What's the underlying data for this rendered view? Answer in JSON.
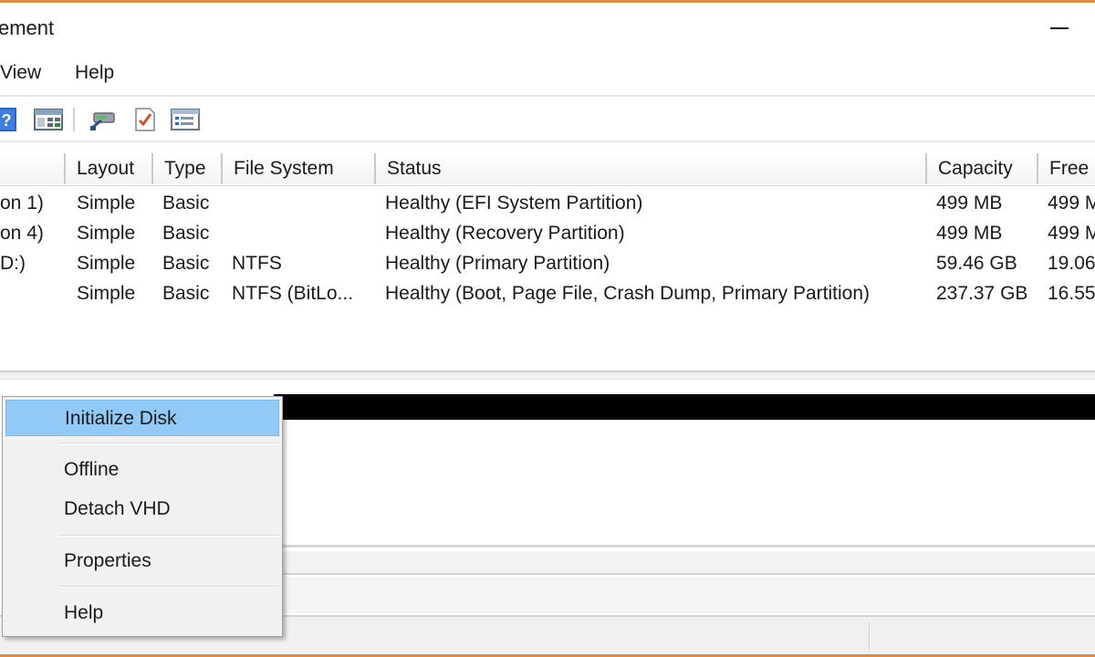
{
  "window": {
    "title": "ement",
    "minimize_icon": "minimize-icon",
    "frame_color": "#e08b45"
  },
  "menubar": {
    "items": [
      "View",
      "Help"
    ]
  },
  "toolbar": {
    "icons": [
      "help-icon",
      "show-hide-console-tree-icon",
      "connect-disk-icon",
      "check-properties-icon",
      "list-view-icon"
    ]
  },
  "volume_list": {
    "columns": [
      "Layout",
      "Type",
      "File System",
      "Status",
      "Capacity",
      "Free"
    ],
    "rows": [
      {
        "volume": "on 1)",
        "layout": "Simple",
        "type": "Basic",
        "file_system": "",
        "status": "Healthy (EFI System Partition)",
        "capacity": "499 MB",
        "free": "499 M"
      },
      {
        "volume": "on 4)",
        "layout": "Simple",
        "type": "Basic",
        "file_system": "",
        "status": "Healthy (Recovery Partition)",
        "capacity": "499 MB",
        "free": "499 M"
      },
      {
        "volume": "D:)",
        "layout": "Simple",
        "type": "Basic",
        "file_system": "NTFS",
        "status": "Healthy (Primary Partition)",
        "capacity": "59.46 GB",
        "free": "19.06"
      },
      {
        "volume": "",
        "layout": "Simple",
        "type": "Basic",
        "file_system": "NTFS (BitLo...",
        "status": "Healthy (Boot, Page File, Crash Dump, Primary Partition)",
        "capacity": "237.37 GB",
        "free": "16.55"
      }
    ]
  },
  "context_menu": {
    "items": [
      "Initialize Disk",
      "Offline",
      "Detach VHD",
      "Properties",
      "Help"
    ],
    "selected_color": "#91c9f7"
  }
}
